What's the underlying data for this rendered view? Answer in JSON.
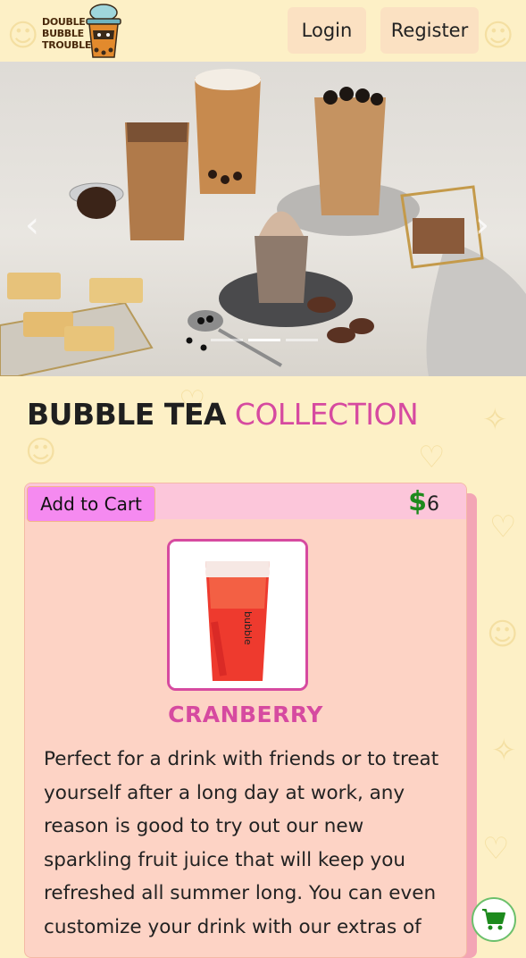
{
  "header": {
    "logo_lines": [
      "DOUBLE",
      "BUBBLE",
      "TROUBLE"
    ],
    "login_label": "Login",
    "register_label": "Register"
  },
  "hero": {
    "prev_arrow": "‹",
    "next_arrow": "›",
    "slide_count": 3,
    "active_slide": 2
  },
  "section": {
    "title_main": "BUBBLE TEA",
    "title_accent": "COLLECTION"
  },
  "product": {
    "add_to_cart_label": "Add to Cart",
    "currency": "$",
    "price": "6",
    "cup_label": "bubble",
    "name": "CRANBERRY",
    "description": "Perfect for a drink with friends or to treat yourself after a long day at work, any reason is good to try out our new sparkling fruit juice that will keep you refreshed all summer long. You can even customize your drink with our extras of"
  },
  "colors": {
    "background": "#fdf0c6",
    "accent_pink": "#d64aa0",
    "card": "#fdd3c5",
    "price_green": "#1d8a1d"
  },
  "icons": {
    "cart_fab": "shopping-cart-icon"
  }
}
